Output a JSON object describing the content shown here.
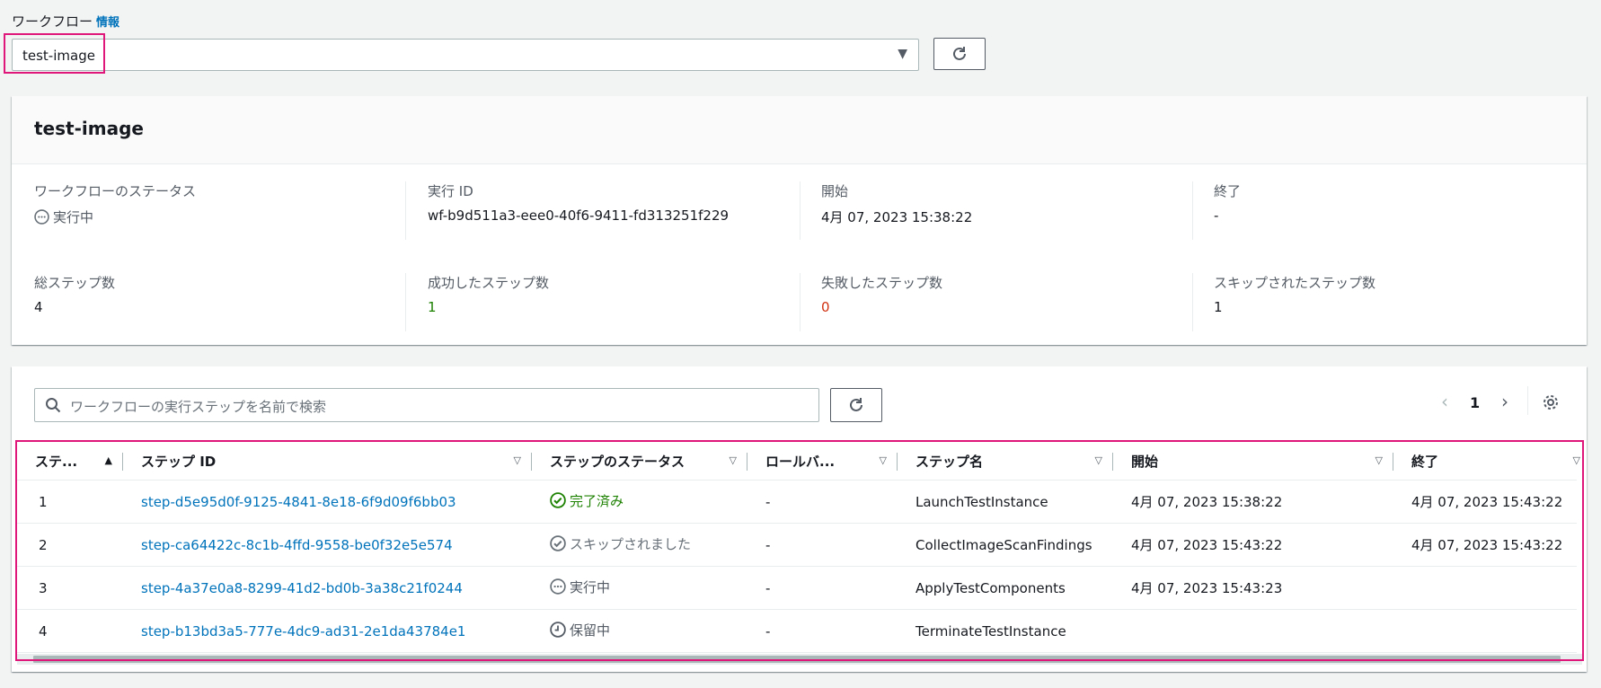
{
  "workflow": {
    "label": "ワークフロー",
    "info_link": "情報",
    "selected": "test-image"
  },
  "summary": {
    "title": "test-image",
    "fields": [
      {
        "label": "ワークフローのステータス",
        "value": "実行中"
      },
      {
        "label": "実行 ID",
        "value": "wf-b9d511a3-eee0-40f6-9411-fd313251f229"
      },
      {
        "label": "開始",
        "value": "4月 07, 2023 15:38:22"
      },
      {
        "label": "終了",
        "value": "-"
      },
      {
        "label": "総ステップ数",
        "value": "4"
      },
      {
        "label": "成功したステップ数",
        "value": "1"
      },
      {
        "label": "失敗したステップ数",
        "value": "0"
      },
      {
        "label": "スキップされたステップ数",
        "value": "1"
      }
    ]
  },
  "steps": {
    "search_placeholder": "ワークフローの実行ステップを名前で検索",
    "page": "1",
    "columns": [
      "ステ...",
      "ステップ ID",
      "ステップのステータス",
      "ロールバ...",
      "ステップ名",
      "開始",
      "終了"
    ],
    "rows": [
      {
        "n": "1",
        "id": "step-d5e95d0f-9125-4841-8e18-6f9d09f6bb03",
        "status": "完了済み",
        "rollback": "-",
        "name": "LaunchTestInstance",
        "start": "4月 07, 2023 15:38:22",
        "end": "4月 07, 2023 15:43:22"
      },
      {
        "n": "2",
        "id": "step-ca64422c-8c1b-4ffd-9558-be0f32e5e574",
        "status": "スキップされました",
        "rollback": "-",
        "name": "CollectImageScanFindings",
        "start": "4月 07, 2023 15:43:22",
        "end": "4月 07, 2023 15:43:22"
      },
      {
        "n": "3",
        "id": "step-4a37e0a8-8299-41d2-bd0b-3a38c21f0244",
        "status": "実行中",
        "rollback": "-",
        "name": "ApplyTestComponents",
        "start": "4月 07, 2023 15:43:23",
        "end": ""
      },
      {
        "n": "4",
        "id": "step-b13bd3a5-777e-4dc9-ad31-2e1da43784e1",
        "status": "保留中",
        "rollback": "-",
        "name": "TerminateTestInstance",
        "start": "",
        "end": ""
      }
    ]
  },
  "colors": {
    "link": "#0073bb",
    "success": "#1d8102",
    "error": "#d13212",
    "highlight": "#e0177a"
  }
}
